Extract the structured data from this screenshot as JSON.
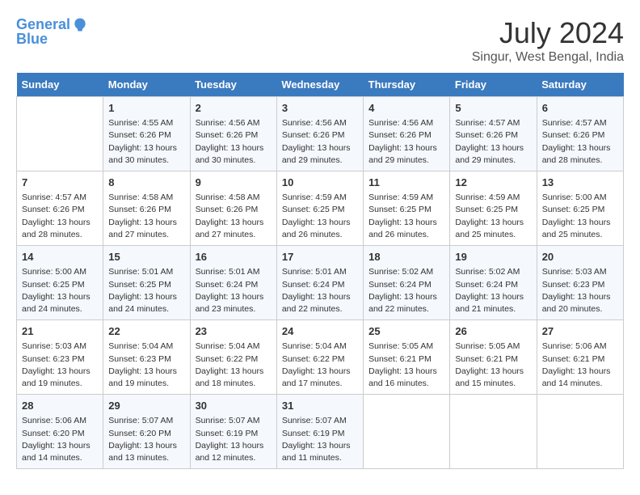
{
  "header": {
    "logo_line1": "General",
    "logo_line2": "Blue",
    "title": "July 2024",
    "subtitle": "Singur, West Bengal, India"
  },
  "days_of_week": [
    "Sunday",
    "Monday",
    "Tuesday",
    "Wednesday",
    "Thursday",
    "Friday",
    "Saturday"
  ],
  "weeks": [
    [
      {
        "day": "",
        "info": ""
      },
      {
        "day": "1",
        "info": "Sunrise: 4:55 AM\nSunset: 6:26 PM\nDaylight: 13 hours\nand 30 minutes."
      },
      {
        "day": "2",
        "info": "Sunrise: 4:56 AM\nSunset: 6:26 PM\nDaylight: 13 hours\nand 30 minutes."
      },
      {
        "day": "3",
        "info": "Sunrise: 4:56 AM\nSunset: 6:26 PM\nDaylight: 13 hours\nand 29 minutes."
      },
      {
        "day": "4",
        "info": "Sunrise: 4:56 AM\nSunset: 6:26 PM\nDaylight: 13 hours\nand 29 minutes."
      },
      {
        "day": "5",
        "info": "Sunrise: 4:57 AM\nSunset: 6:26 PM\nDaylight: 13 hours\nand 29 minutes."
      },
      {
        "day": "6",
        "info": "Sunrise: 4:57 AM\nSunset: 6:26 PM\nDaylight: 13 hours\nand 28 minutes."
      }
    ],
    [
      {
        "day": "7",
        "info": "Sunrise: 4:57 AM\nSunset: 6:26 PM\nDaylight: 13 hours\nand 28 minutes."
      },
      {
        "day": "8",
        "info": "Sunrise: 4:58 AM\nSunset: 6:26 PM\nDaylight: 13 hours\nand 27 minutes."
      },
      {
        "day": "9",
        "info": "Sunrise: 4:58 AM\nSunset: 6:26 PM\nDaylight: 13 hours\nand 27 minutes."
      },
      {
        "day": "10",
        "info": "Sunrise: 4:59 AM\nSunset: 6:25 PM\nDaylight: 13 hours\nand 26 minutes."
      },
      {
        "day": "11",
        "info": "Sunrise: 4:59 AM\nSunset: 6:25 PM\nDaylight: 13 hours\nand 26 minutes."
      },
      {
        "day": "12",
        "info": "Sunrise: 4:59 AM\nSunset: 6:25 PM\nDaylight: 13 hours\nand 25 minutes."
      },
      {
        "day": "13",
        "info": "Sunrise: 5:00 AM\nSunset: 6:25 PM\nDaylight: 13 hours\nand 25 minutes."
      }
    ],
    [
      {
        "day": "14",
        "info": "Sunrise: 5:00 AM\nSunset: 6:25 PM\nDaylight: 13 hours\nand 24 minutes."
      },
      {
        "day": "15",
        "info": "Sunrise: 5:01 AM\nSunset: 6:25 PM\nDaylight: 13 hours\nand 24 minutes."
      },
      {
        "day": "16",
        "info": "Sunrise: 5:01 AM\nSunset: 6:24 PM\nDaylight: 13 hours\nand 23 minutes."
      },
      {
        "day": "17",
        "info": "Sunrise: 5:01 AM\nSunset: 6:24 PM\nDaylight: 13 hours\nand 22 minutes."
      },
      {
        "day": "18",
        "info": "Sunrise: 5:02 AM\nSunset: 6:24 PM\nDaylight: 13 hours\nand 22 minutes."
      },
      {
        "day": "19",
        "info": "Sunrise: 5:02 AM\nSunset: 6:24 PM\nDaylight: 13 hours\nand 21 minutes."
      },
      {
        "day": "20",
        "info": "Sunrise: 5:03 AM\nSunset: 6:23 PM\nDaylight: 13 hours\nand 20 minutes."
      }
    ],
    [
      {
        "day": "21",
        "info": "Sunrise: 5:03 AM\nSunset: 6:23 PM\nDaylight: 13 hours\nand 19 minutes."
      },
      {
        "day": "22",
        "info": "Sunrise: 5:04 AM\nSunset: 6:23 PM\nDaylight: 13 hours\nand 19 minutes."
      },
      {
        "day": "23",
        "info": "Sunrise: 5:04 AM\nSunset: 6:22 PM\nDaylight: 13 hours\nand 18 minutes."
      },
      {
        "day": "24",
        "info": "Sunrise: 5:04 AM\nSunset: 6:22 PM\nDaylight: 13 hours\nand 17 minutes."
      },
      {
        "day": "25",
        "info": "Sunrise: 5:05 AM\nSunset: 6:21 PM\nDaylight: 13 hours\nand 16 minutes."
      },
      {
        "day": "26",
        "info": "Sunrise: 5:05 AM\nSunset: 6:21 PM\nDaylight: 13 hours\nand 15 minutes."
      },
      {
        "day": "27",
        "info": "Sunrise: 5:06 AM\nSunset: 6:21 PM\nDaylight: 13 hours\nand 14 minutes."
      }
    ],
    [
      {
        "day": "28",
        "info": "Sunrise: 5:06 AM\nSunset: 6:20 PM\nDaylight: 13 hours\nand 14 minutes."
      },
      {
        "day": "29",
        "info": "Sunrise: 5:07 AM\nSunset: 6:20 PM\nDaylight: 13 hours\nand 13 minutes."
      },
      {
        "day": "30",
        "info": "Sunrise: 5:07 AM\nSunset: 6:19 PM\nDaylight: 13 hours\nand 12 minutes."
      },
      {
        "day": "31",
        "info": "Sunrise: 5:07 AM\nSunset: 6:19 PM\nDaylight: 13 hours\nand 11 minutes."
      },
      {
        "day": "",
        "info": ""
      },
      {
        "day": "",
        "info": ""
      },
      {
        "day": "",
        "info": ""
      }
    ]
  ]
}
